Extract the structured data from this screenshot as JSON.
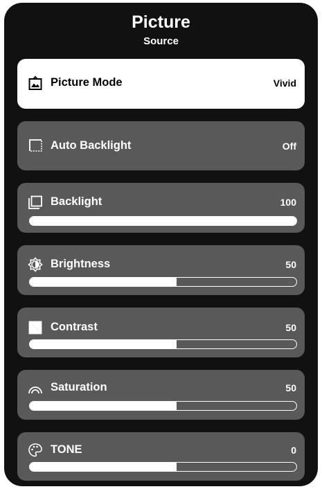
{
  "header": {
    "title": "Picture",
    "subtitle": "Source"
  },
  "colors": {
    "panel": "#111111",
    "item": "#595959",
    "selected_item": "#ffffff",
    "text": "#ffffff"
  },
  "items": [
    {
      "label": "Picture Mode",
      "value": "Vivid",
      "icon": "picture-mode-icon",
      "selected": true
    },
    {
      "label": "Auto Backlight",
      "value": "Off",
      "icon": "auto-backlight-icon"
    },
    {
      "label": "Backlight",
      "value": "100",
      "icon": "backlight-icon",
      "level": 1.0
    },
    {
      "label": "Brightness",
      "value": "50",
      "icon": "brightness-icon",
      "level": 0.55
    },
    {
      "label": "Contrast",
      "value": "50",
      "icon": "contrast-icon",
      "level": 0.55
    },
    {
      "label": "Saturation",
      "value": "50",
      "icon": "saturation-icon",
      "level": 0.55
    },
    {
      "label": "TONE",
      "value": "0",
      "icon": "tone-icon",
      "level": 0.55
    }
  ]
}
